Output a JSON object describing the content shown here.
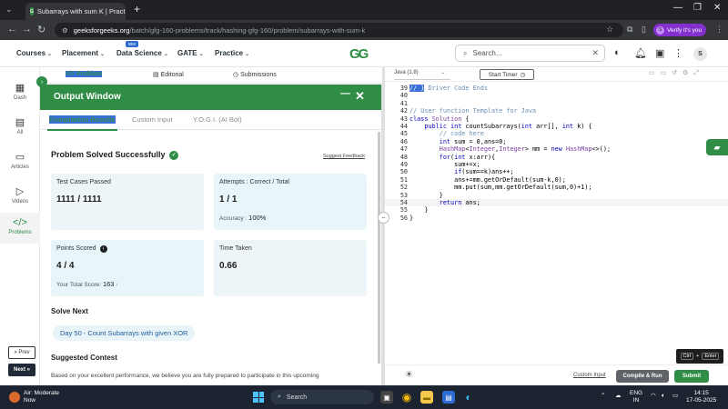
{
  "browser": {
    "tab_title": "Subarrays with sum K | Practice",
    "url_host": "geeksforgeeks.org",
    "url_path": "/batch/gfg-160-problems/track/hashing-gfg-160/problem/subarrays-with-sum-k",
    "verify_label": "Verify it's you",
    "verify_initial": "S"
  },
  "nav": {
    "items": [
      "Courses",
      "Placement",
      "Data Science",
      "GATE",
      "Practice"
    ],
    "badge": "IBM",
    "logo": "GG",
    "search_placeholder": "Search...",
    "avatar": "S"
  },
  "rail": {
    "items": [
      {
        "label": "Dash",
        "icon": "▦"
      },
      {
        "label": "All",
        "icon": "▤"
      },
      {
        "label": "Articles",
        "icon": "▭"
      },
      {
        "label": "Videos",
        "icon": "▷"
      },
      {
        "label": "Problems",
        "icon": "</>"
      }
    ],
    "prev": "« Prev",
    "next": "Next »"
  },
  "problem_tabs": [
    "Problem",
    "Editorial",
    "Submissions"
  ],
  "output": {
    "title": "Output Window",
    "tabs": [
      "Compilation Results",
      "Custom Input",
      "Y.O.G.I. (AI Bot)"
    ],
    "status": "Problem Solved Successfully",
    "feedback": "Suggest Feedback",
    "test_cases_label": "Test Cases Passed",
    "test_cases_value": "1111 / 1111",
    "attempts_label": "Attempts : Correct / Total",
    "attempts_value": "1 / 1",
    "accuracy_label": "Accuracy :",
    "accuracy_value": "100%",
    "points_label": "Points Scored",
    "points_value": "4 / 4",
    "total_score_label": "Your Total Score:",
    "total_score_value": "163",
    "time_label": "Time Taken",
    "time_value": "0.66",
    "solve_next_title": "Solve Next",
    "solve_next_chip": "Day 50 - Count Subarrays with given XOR",
    "suggested_title": "Suggested Contest",
    "suggested_text": "Based on your excellent performance, we believe you are fully prepared to participate in this upcoming"
  },
  "editor": {
    "language": "Java (1.8)",
    "timer": "Start Timer",
    "lines": [
      {
        "n": "39",
        "t": "// } Driver Code Ends"
      },
      {
        "n": "40",
        "t": ""
      },
      {
        "n": "41",
        "t": ""
      },
      {
        "n": "42",
        "t": "// User function Template for Java"
      },
      {
        "n": "43",
        "t": "class Solution {"
      },
      {
        "n": "44",
        "t": "    public int countSubarrays(int arr[], int k) {"
      },
      {
        "n": "45",
        "t": "        // code here"
      },
      {
        "n": "46",
        "t": "        int sum = 0,ans=0;"
      },
      {
        "n": "47",
        "t": "        HashMap<Integer,Integer> mm = new HashMap<>();"
      },
      {
        "n": "48",
        "t": "        for(int x:arr){"
      },
      {
        "n": "49",
        "t": "            sum+=x;"
      },
      {
        "n": "50",
        "t": "            if(sum==k)ans++;"
      },
      {
        "n": "51",
        "t": "            ans+=mm.getOrDefault(sum-k,0);"
      },
      {
        "n": "52",
        "t": "            mm.put(sum,mm.getOrDefault(sum,0)+1);"
      },
      {
        "n": "53",
        "t": "        }"
      },
      {
        "n": "54",
        "t": "        return ans;"
      },
      {
        "n": "55",
        "t": "    }"
      },
      {
        "n": "56",
        "t": "}"
      }
    ],
    "custom_input": "Custom Input",
    "compile": "Compile & Run",
    "submit": "Submit",
    "shortcut_ctrl": "Ctrl",
    "shortcut_plus": "+",
    "shortcut_enter": "Enter"
  },
  "taskbar": {
    "weather_title": "Air: Moderate",
    "weather_sub": "Now",
    "search": "Search",
    "lang": "ENG",
    "lang_sub": "IN",
    "time": "14:15",
    "date": "17-05-2025"
  },
  "colors": {
    "gfg_green": "#2f8d46",
    "taskbar": "#1c2431",
    "chrome_dark": "#202124"
  }
}
